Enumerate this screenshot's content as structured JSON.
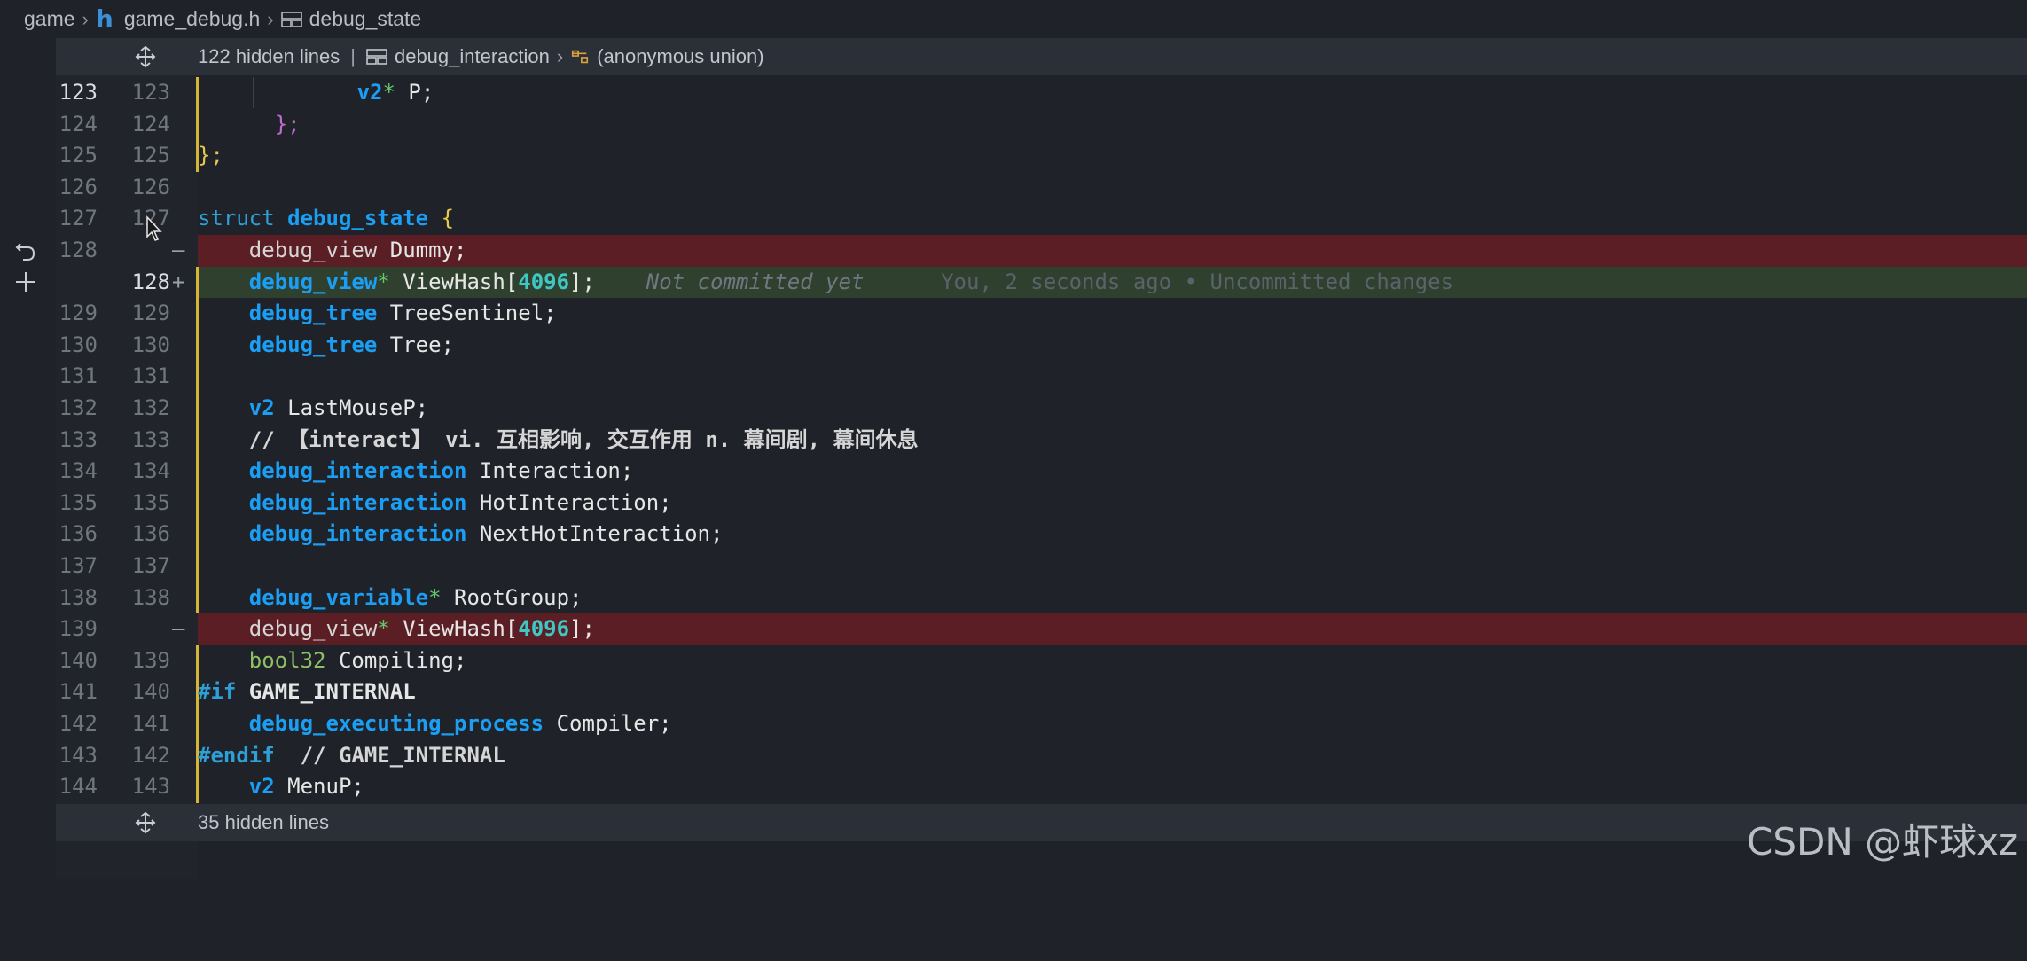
{
  "breadcrumb": {
    "items": [
      "game",
      "game_debug.h",
      "debug_state"
    ],
    "file_icon": "h"
  },
  "fold_top": {
    "hidden": "122 hidden lines",
    "path1": "debug_interaction",
    "path2": "(anonymous union)"
  },
  "fold_bottom": {
    "hidden": "35 hidden lines"
  },
  "lines": [
    {
      "old": "123",
      "new": "123"
    },
    {
      "old": "124",
      "new": "124"
    },
    {
      "old": "125",
      "new": "125"
    },
    {
      "old": "126",
      "new": "126"
    },
    {
      "old": "127",
      "new": "127"
    },
    {
      "old": "128",
      "new": "",
      "marker": "—"
    },
    {
      "old": "",
      "new": "128",
      "marker": "+"
    },
    {
      "old": "129",
      "new": "129"
    },
    {
      "old": "130",
      "new": "130"
    },
    {
      "old": "131",
      "new": "131"
    },
    {
      "old": "132",
      "new": "132"
    },
    {
      "old": "133",
      "new": "133"
    },
    {
      "old": "134",
      "new": "134"
    },
    {
      "old": "135",
      "new": "135"
    },
    {
      "old": "136",
      "new": "136"
    },
    {
      "old": "137",
      "new": "137"
    },
    {
      "old": "138",
      "new": "138"
    },
    {
      "old": "139",
      "new": "",
      "marker": "—"
    },
    {
      "old": "140",
      "new": "139"
    },
    {
      "old": "141",
      "new": "140"
    },
    {
      "old": "142",
      "new": "141"
    },
    {
      "old": "143",
      "new": "142"
    },
    {
      "old": "144",
      "new": "143"
    }
  ],
  "code": {
    "l123_type": "v2",
    "l123_ptr": "*",
    "l123_name": " P;",
    "l124": "};",
    "l125": "};",
    "l127_kw": "struct",
    "l127_name": "debug_state",
    "l127_brace": "{",
    "l128_type": "debug_view",
    "l128_name": " Dummy;",
    "l128n_type": "debug_view",
    "l128n_ptr": "*",
    "l128n_name": " ViewHash[",
    "l128n_num": "4096",
    "l128n_end": "];",
    "l128n_blame1": "Not committed yet",
    "l128n_blame2": "You, 2 seconds ago • Uncommitted changes",
    "l129_type": "debug_tree",
    "l129_name": " TreeSentinel;",
    "l130_type": "debug_tree",
    "l130_name": " Tree;",
    "l132_type": "v2",
    "l132_name": " LastMouseP;",
    "l133_comment": "// 【interact】 vi. 互相影响, 交互作用 n. 幕间剧, 幕间休息",
    "l134_type": "debug_interaction",
    "l134_name": " Interaction;",
    "l135_type": "debug_interaction",
    "l135_name": " HotInteraction;",
    "l136_type": "debug_interaction",
    "l136_name": " NextHotInteraction;",
    "l138_type": "debug_variable",
    "l138_ptr": "*",
    "l138_name": " RootGroup;",
    "l139_type": "debug_view",
    "l139_ptr": "*",
    "l139_name": " ViewHash[",
    "l139_num": "4096",
    "l139_end": "];",
    "l140_type": "bool32",
    "l140_name": " Compiling;",
    "l141_pp": "#if",
    "l141_macro": " GAME_INTERNAL",
    "l142_type": "debug_executing_process",
    "l142_name": " Compiler;",
    "l143_pp": "#endif",
    "l143_comment": "  // GAME_INTERNAL",
    "l144_type": "v2",
    "l144_name": " MenuP;"
  },
  "watermark": "CSDN @虾球xz",
  "colors": {
    "background": "#1f2329",
    "deleted_line": "#5a1e24",
    "added_line": "#30402f",
    "modified_bar": "#d5b43a",
    "keyword": "#2f9fd7"
  }
}
